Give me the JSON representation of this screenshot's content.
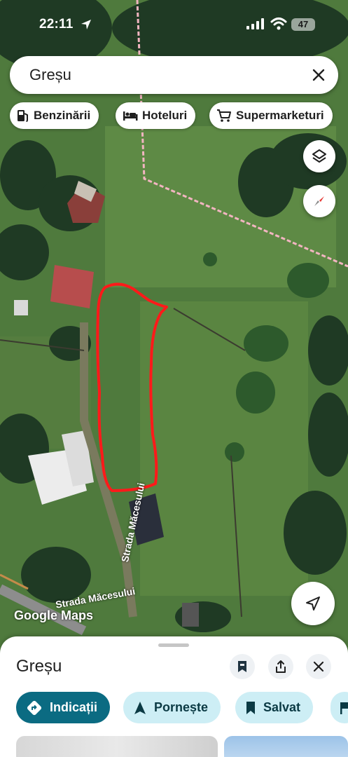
{
  "status_bar": {
    "time": "22:11",
    "battery": "47"
  },
  "search": {
    "query": "Greșu"
  },
  "chips": [
    {
      "label": "Benzinării",
      "icon": "gas-station-icon"
    },
    {
      "label": "Hoteluri",
      "icon": "bed-icon"
    },
    {
      "label": "Supermarketuri",
      "icon": "shopping-cart-icon"
    }
  ],
  "map": {
    "watermark": "Google Maps",
    "street_label": "Strada Măcesului",
    "street_label_2": "Strada Măcesului",
    "controls": [
      "layers-icon",
      "compass-icon",
      "navigation-icon"
    ]
  },
  "place": {
    "title": "Greșu",
    "actions": [
      {
        "label": "Indicații",
        "icon": "directions-icon"
      },
      {
        "label": "Pornește",
        "icon": "navigation-arrow-icon"
      },
      {
        "label": "Salvat",
        "icon": "bookmark-icon"
      }
    ]
  },
  "colors": {
    "primary_action": "#0b6b82",
    "secondary_action": "#cdeef5",
    "outline_marker": "#ff1a1a"
  }
}
